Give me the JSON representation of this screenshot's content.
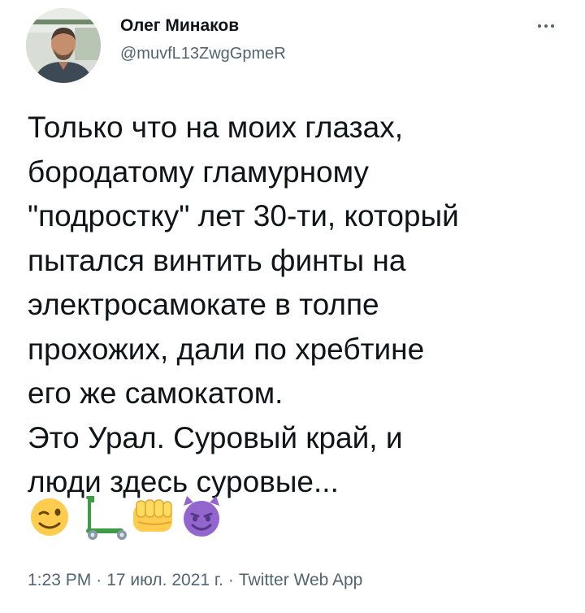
{
  "author": {
    "display_name": "Олег Минаков",
    "handle": "@muvfL13ZwgGpmeR"
  },
  "tweet": {
    "lines": [
      "Только что на моих глазах,",
      "бородатому гламурному",
      "\"подростку\" лет 30-ти, который",
      "пытался винтить финты на",
      "электросамокате в толпе",
      "прохожих, дали по хребтине",
      "его же самокатом.",
      "Это Урал. Суровый край, и",
      "люди здесь суровые..."
    ],
    "emojis": [
      "winking-face-emoji",
      "kick-scooter-emoji",
      "oncoming-fist-emoji",
      "smiling-face-with-horns-emoji"
    ]
  },
  "meta": {
    "time": "1:23 PM",
    "date": "17 июл. 2021 г.",
    "source": "Twitter Web App",
    "separator": "·"
  },
  "colors": {
    "text": "#0f1419",
    "secondary": "#536471",
    "emoji_yellow": "#ffcc4d",
    "emoji_purple": "#9266cc",
    "scooter_green": "#3f9b47"
  }
}
